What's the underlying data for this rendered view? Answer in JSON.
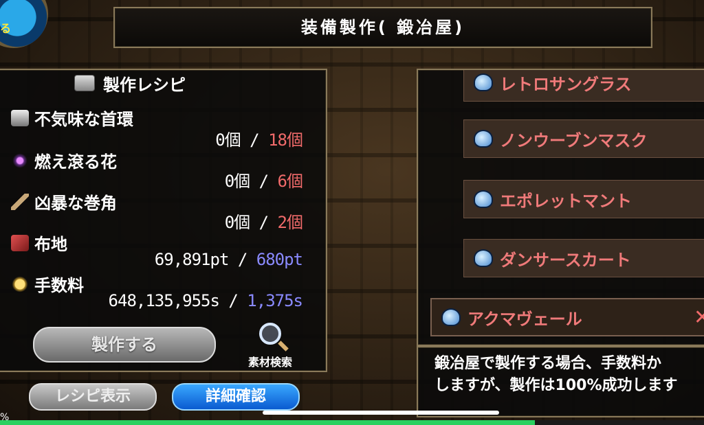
{
  "menu": {
    "label": "る"
  },
  "title": "装備製作( 鍛冶屋)",
  "recipe": {
    "header": "製作レシピ",
    "materials": [
      {
        "name": "不気味な首環",
        "icon": "metal-collar-icon",
        "have": "0個",
        "need": "18個",
        "need_color": "red"
      },
      {
        "name": "燃え滾る花",
        "icon": "purple-flower-icon",
        "have": "0個",
        "need": "6個",
        "need_color": "red"
      },
      {
        "name": "凶暴な巻角",
        "icon": "horn-icon",
        "have": "0個",
        "need": "2個",
        "need_color": "red"
      },
      {
        "name": "布地",
        "icon": "red-cloth-icon",
        "have": "69,891pt",
        "need": "680pt",
        "need_color": "blue"
      },
      {
        "name": "手数料",
        "icon": "coins-icon",
        "have": "648,135,955s",
        "need": "1,375s",
        "need_color": "blue"
      }
    ],
    "craft_button": "製作する",
    "search_label": "素材検索"
  },
  "bottom": {
    "recipe_view": "レシピ表示",
    "details": "詳細確認"
  },
  "items": [
    "レトロサングラス",
    "ノンウーブンマスク",
    "エポレットマント",
    "ダンサースカート",
    "アクマヴェール"
  ],
  "description": "鍛冶屋で製作する場合、手数料か\nしますが、製作は100%成功します",
  "status": {
    "xp_label": "%",
    "xp_fraction": 0.76
  },
  "colors": {
    "red": "#f06a6a",
    "blue": "#8a8aff",
    "accent": "#2ad060"
  }
}
